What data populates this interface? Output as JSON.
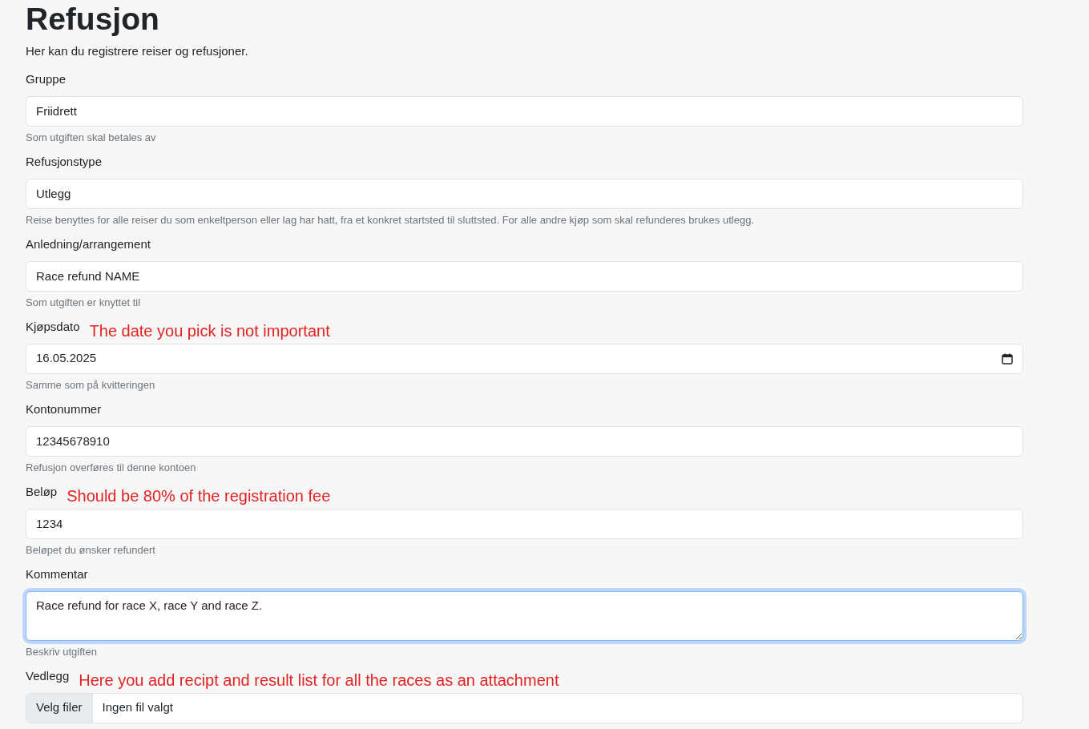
{
  "title": "Refusjon",
  "intro": "Her kan du registrere reiser og refusjoner.",
  "fields": [
    {
      "kind": "text",
      "label": "Gruppe",
      "value": "Friidrett",
      "help": "Som utgiften skal betales av",
      "focused": false
    },
    {
      "kind": "text",
      "label": "Refusjonstype",
      "value": "Utlegg",
      "help": "Reise benyttes for alle reiser du som enkeltperson eller lag har hatt, fra et konkret startsted til sluttsted. For alle andre kjøp som skal refunderes brukes utlegg.",
      "focused": false
    },
    {
      "kind": "text",
      "label": "Anledning/arrangement",
      "value": "Race refund NAME",
      "help": "Som utgiften er knyttet til",
      "focused": false
    },
    {
      "kind": "date",
      "label": "Kjøpsdato",
      "annotation": "The date you pick is not important",
      "value": "16.05.2025",
      "help": "Samme som på kvitteringen",
      "focused": false
    },
    {
      "kind": "text",
      "label": "Kontonummer",
      "value": "12345678910",
      "help": "Refusjon overføres til denne kontoen",
      "focused": false
    },
    {
      "kind": "text",
      "label": "Beløp",
      "annotation": "Should be 80% of the registration fee",
      "value": "1234",
      "help": "Beløpet du ønsker refundert",
      "focused": false
    },
    {
      "kind": "textarea",
      "label": "Kommentar",
      "value": "Race refund for race X, race Y and race Z.",
      "help": "Beskriv utgiften",
      "focused": true
    },
    {
      "kind": "file",
      "label": "Vedlegg",
      "annotation": "Here you add recipt and result list for all the races as an attachment",
      "button": "Velg filer",
      "value": "Ingen fil valgt",
      "focused": false
    }
  ]
}
